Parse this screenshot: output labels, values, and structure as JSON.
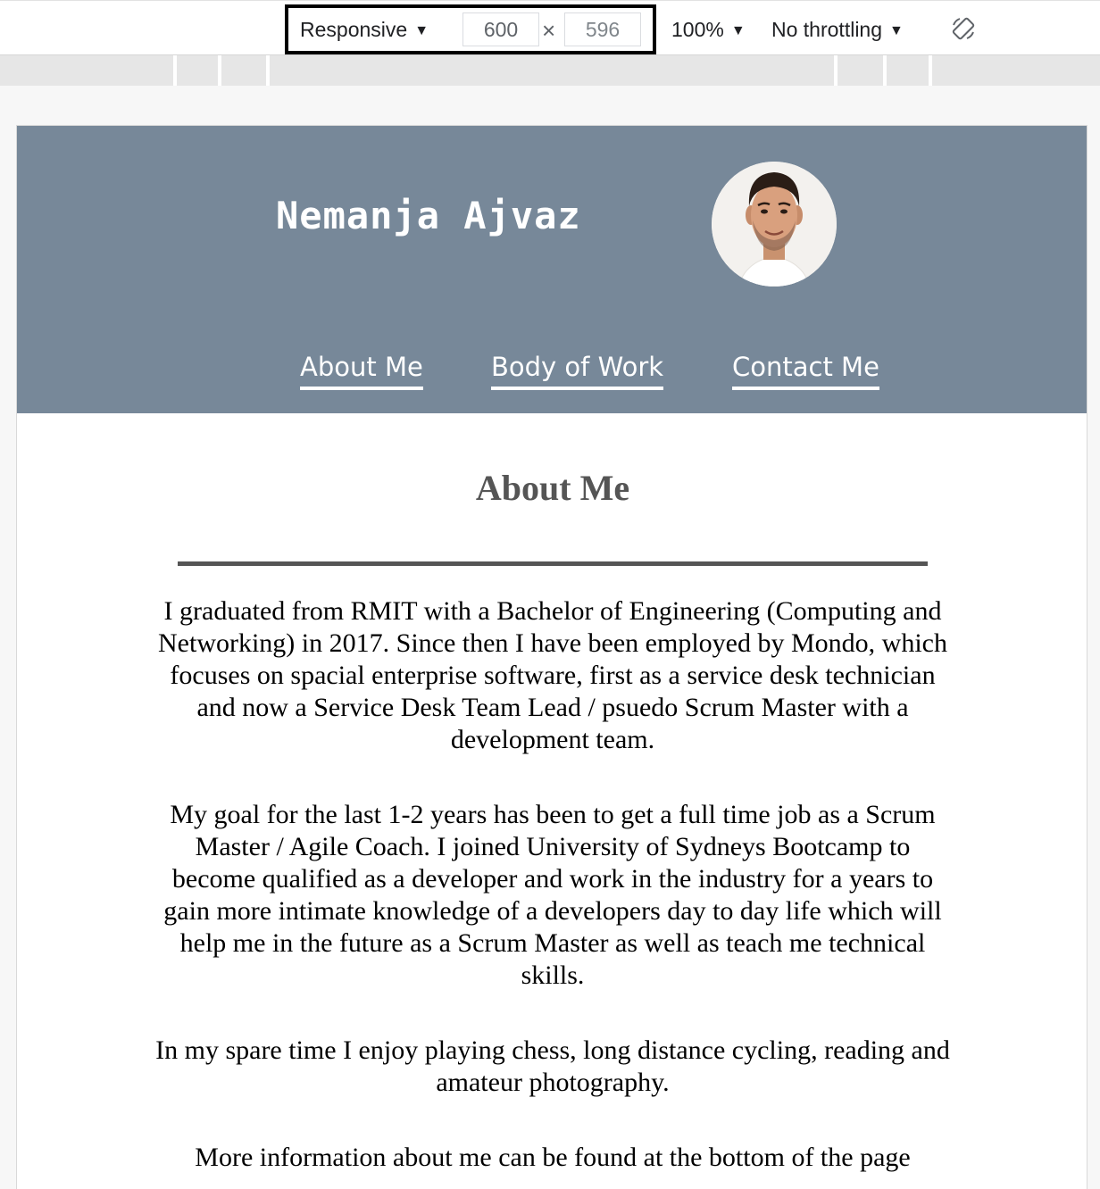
{
  "devtools": {
    "device_mode": "Responsive",
    "width": "600",
    "height": "596",
    "times_sign": "×",
    "zoom": "100%",
    "throttling": "No throttling",
    "icons": {
      "dropdown": "caret-down-icon",
      "rotate": "rotate-icon"
    }
  },
  "site": {
    "title": "Nemanja Ajvaz",
    "header_color": "#778899",
    "nav": [
      {
        "label": "About Me"
      },
      {
        "label": "Body of Work"
      },
      {
        "label": "Contact Me"
      }
    ]
  },
  "about": {
    "heading": "About Me",
    "paragraphs": [
      "I graduated from RMIT with a Bachelor of Engineering (Computing and Networking) in 2017. Since then I have been employed by Mondo, which focuses on spacial enterprise software, first as a service desk technician and now a Service Desk Team Lead / psuedo Scrum Master with a development team.",
      "My goal for the last 1-2 years has been to get a full time job as a Scrum Master / Agile Coach. I joined University of Sydneys Bootcamp to become qualified as a developer and work in the industry for a years to gain more intimate knowledge of a developers day to day life which will help me in the future as a Scrum Master as well as teach me technical skills.",
      "In my spare time I enjoy playing chess, long distance cycling, reading and amateur photography.",
      "More information about me can be found at the bottom of the page"
    ]
  }
}
